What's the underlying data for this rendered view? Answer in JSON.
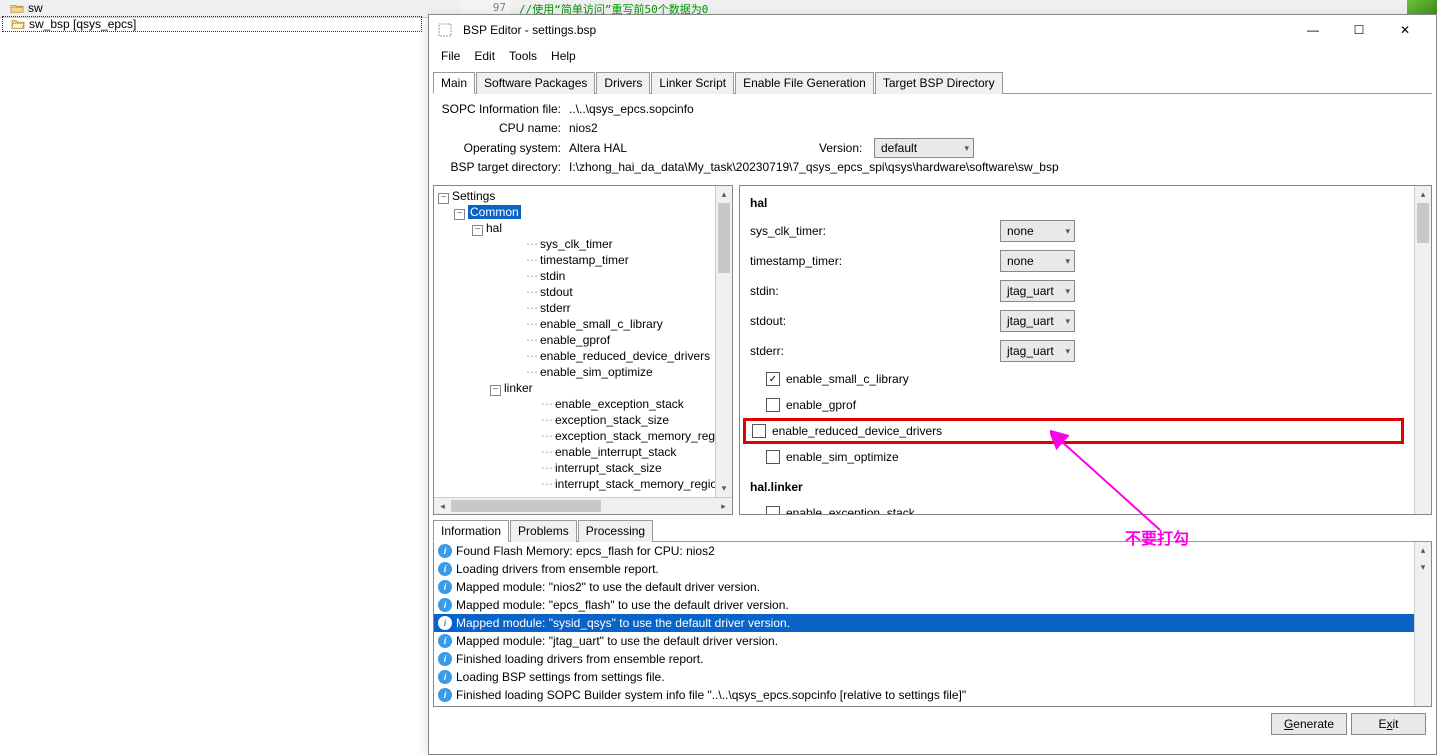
{
  "background": {
    "file_items": [
      "sw",
      "sw_bsp [qsys_epcs]"
    ],
    "gutter_line": "97",
    "code_comment": "//使用“简单访问”重写前50个数据为0"
  },
  "window": {
    "title": "BSP Editor - settings.bsp",
    "menus": [
      "File",
      "Edit",
      "Tools",
      "Help"
    ],
    "controls": {
      "min": "—",
      "max": "☐",
      "close": "✕"
    }
  },
  "tabs": [
    "Main",
    "Software Packages",
    "Drivers",
    "Linker Script",
    "Enable File Generation",
    "Target BSP Directory"
  ],
  "info": {
    "sopc_label": "SOPC Information file:",
    "sopc_val": "..\\..\\qsys_epcs.sopcinfo",
    "cpu_label": "CPU name:",
    "cpu_val": "nios2",
    "os_label": "Operating system:",
    "os_val": "Altera HAL",
    "version_label": "Version:",
    "version_val": "default",
    "bsp_dir_label": "BSP target directory:",
    "bsp_dir_val": "I:\\zhong_hai_da_data\\My_task\\20230719\\7_qsys_epcs_spi\\qsys\\hardware\\software\\sw_bsp"
  },
  "tree": {
    "root": "Settings",
    "common": "Common",
    "hal": "hal",
    "hal_children": [
      "sys_clk_timer",
      "timestamp_timer",
      "stdin",
      "stdout",
      "stderr",
      "enable_small_c_library",
      "enable_gprof",
      "enable_reduced_device_drivers",
      "enable_sim_optimize"
    ],
    "linker": "linker",
    "linker_children": [
      "enable_exception_stack",
      "exception_stack_size",
      "exception_stack_memory_region_…",
      "enable_interrupt_stack",
      "interrupt_stack_size",
      "interrupt_stack_memory_region_n…"
    ]
  },
  "props": {
    "header1": "hal",
    "rows": [
      {
        "label": "sys_clk_timer:",
        "value": "none"
      },
      {
        "label": "timestamp_timer:",
        "value": "none"
      },
      {
        "label": "stdin:",
        "value": "jtag_uart"
      },
      {
        "label": "stdout:",
        "value": "jtag_uart"
      },
      {
        "label": "stderr:",
        "value": "jtag_uart"
      }
    ],
    "checks": [
      {
        "label": "enable_small_c_library",
        "checked": true
      },
      {
        "label": "enable_gprof",
        "checked": false
      },
      {
        "label": "enable_reduced_device_drivers",
        "checked": false,
        "highlight": true
      },
      {
        "label": "enable_sim_optimize",
        "checked": false
      }
    ],
    "header2": "hal.linker",
    "checks2": [
      {
        "label": "enable_exception_stack",
        "checked": false
      }
    ]
  },
  "bottom_tabs": [
    "Information",
    "Problems",
    "Processing"
  ],
  "log": [
    "Found Flash Memory: epcs_flash for CPU: nios2",
    "Loading drivers from ensemble report.",
    "Mapped module: \"nios2\" to use the default driver version.",
    "Mapped module: \"epcs_flash\" to use the default driver version.",
    "Mapped module: \"sysid_qsys\" to use the default driver version.",
    "Mapped module: \"jtag_uart\" to use the default driver version.",
    "Finished loading drivers from ensemble report.",
    "Loading BSP settings from settings file.",
    "Finished loading SOPC Builder system info file \"..\\..\\qsys_epcs.sopcinfo [relative to settings file]\""
  ],
  "log_selected_index": 4,
  "footer": {
    "generate": "Generate",
    "exit": "Exit",
    "generate_u": "G",
    "exit_u": "x"
  },
  "annotation": "不要打勾"
}
